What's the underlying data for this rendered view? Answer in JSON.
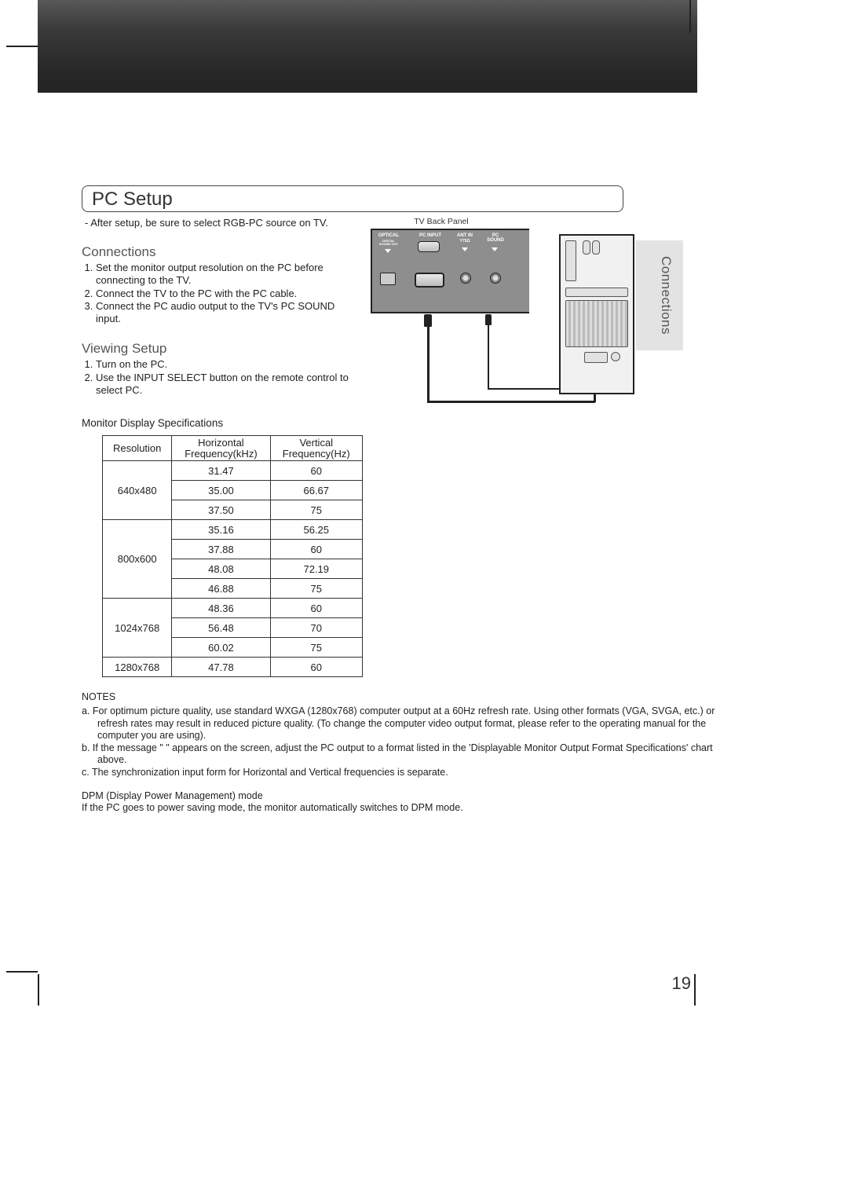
{
  "page_number": "19",
  "side_tab": "Connections",
  "section_title": "PC Setup",
  "intro": "- After setup, be sure to select RGB-PC source on TV.",
  "connections": {
    "heading": "Connections",
    "items": [
      "Set the monitor output resolution on the PC before connecting to the TV.",
      "Connect the TV to the PC with the PC cable.",
      "Connect the PC audio output to the TV's PC SOUND input."
    ]
  },
  "viewing": {
    "heading": "Viewing Setup",
    "items": [
      "Turn on the PC.",
      "Use the INPUT SELECT button on the remote control to select PC."
    ]
  },
  "table_title": "Monitor Display Specifications",
  "table": {
    "headers": [
      "Resolution",
      "Horizontal Frequency(kHz)",
      "Vertical Frequency(Hz)"
    ],
    "rows": [
      {
        "res": "640x480",
        "group": 3,
        "h": "31.47",
        "v": "60"
      },
      {
        "res": "",
        "group": 0,
        "h": "35.00",
        "v": "66.67"
      },
      {
        "res": "",
        "group": 0,
        "h": "37.50",
        "v": "75"
      },
      {
        "res": "800x600",
        "group": 4,
        "h": "35.16",
        "v": "56.25"
      },
      {
        "res": "",
        "group": 0,
        "h": "37.88",
        "v": "60"
      },
      {
        "res": "",
        "group": 0,
        "h": "48.08",
        "v": "72.19"
      },
      {
        "res": "",
        "group": 0,
        "h": "46.88",
        "v": "75"
      },
      {
        "res": "1024x768",
        "group": 3,
        "h": "48.36",
        "v": "60"
      },
      {
        "res": "",
        "group": 0,
        "h": "56.48",
        "v": "70"
      },
      {
        "res": "",
        "group": 0,
        "h": "60.02",
        "v": "75"
      },
      {
        "res": "1280x768",
        "group": 1,
        "h": "47.78",
        "v": "60"
      }
    ]
  },
  "notes": {
    "heading": "NOTES",
    "a": "a. For optimum picture quality, use standard WXGA (1280x768) computer output at a 60Hz refresh rate. Using other formats (VGA, SVGA, etc.) or refresh rates may result in reduced picture quality. (To change the computer video output format, please refer to the operating manual for the computer you are using).",
    "b": "b. If the message \"                       \" appears on the screen, adjust the PC output to a format listed in the 'Displayable Monitor Output Format Specifications' chart above.",
    "c": "c. The synchronization input form for Horizontal and Vertical frequencies is separate."
  },
  "dpm": {
    "title": "DPM (Display Power Management) mode",
    "body": "If the PC goes to power saving mode, the monitor automatically switches to DPM mode."
  },
  "diagram": {
    "title": "TV Back Panel",
    "ports": {
      "optical": "OPTICAL",
      "optical_sub": "DIGITAL SOUND OUT",
      "pc_input": "PC INPUT",
      "ant": "ANT IN",
      "ant_sub": "Y75Ω",
      "pc_sound": "PC SOUND"
    }
  }
}
